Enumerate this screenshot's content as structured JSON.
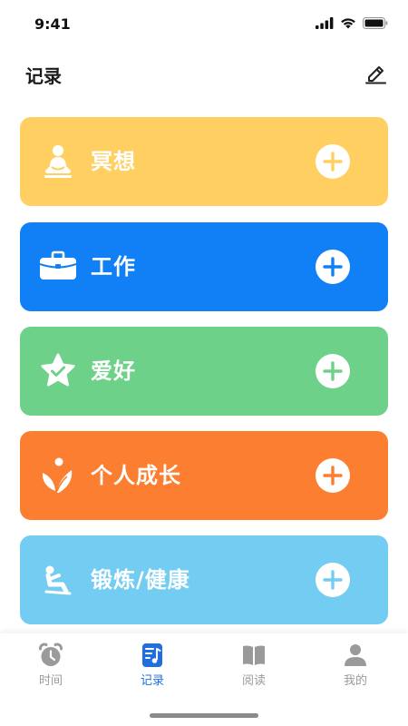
{
  "status_bar": {
    "time": "9:41"
  },
  "header": {
    "title": "记录"
  },
  "categories": [
    {
      "label": "冥想",
      "color": "#FFD061",
      "icon": "meditation-icon"
    },
    {
      "label": "工作",
      "color": "#1180F6",
      "icon": "briefcase-icon"
    },
    {
      "label": "爱好",
      "color": "#6ED189",
      "icon": "star-check-icon"
    },
    {
      "label": "个人成长",
      "color": "#FC7E30",
      "icon": "sprout-icon"
    },
    {
      "label": "锻炼/健康",
      "color": "#73CCF1",
      "icon": "exercise-icon"
    }
  ],
  "tabbar": {
    "items": [
      {
        "label": "时间",
        "icon": "alarm-clock-icon",
        "active": false
      },
      {
        "label": "记录",
        "icon": "music-note-doc-icon",
        "active": true
      },
      {
        "label": "阅读",
        "icon": "book-icon",
        "active": false
      },
      {
        "label": "我的",
        "icon": "person-icon",
        "active": false
      }
    ]
  },
  "colors": {
    "accent": "#1F6FE0",
    "inactive": "#9A9A9A"
  }
}
